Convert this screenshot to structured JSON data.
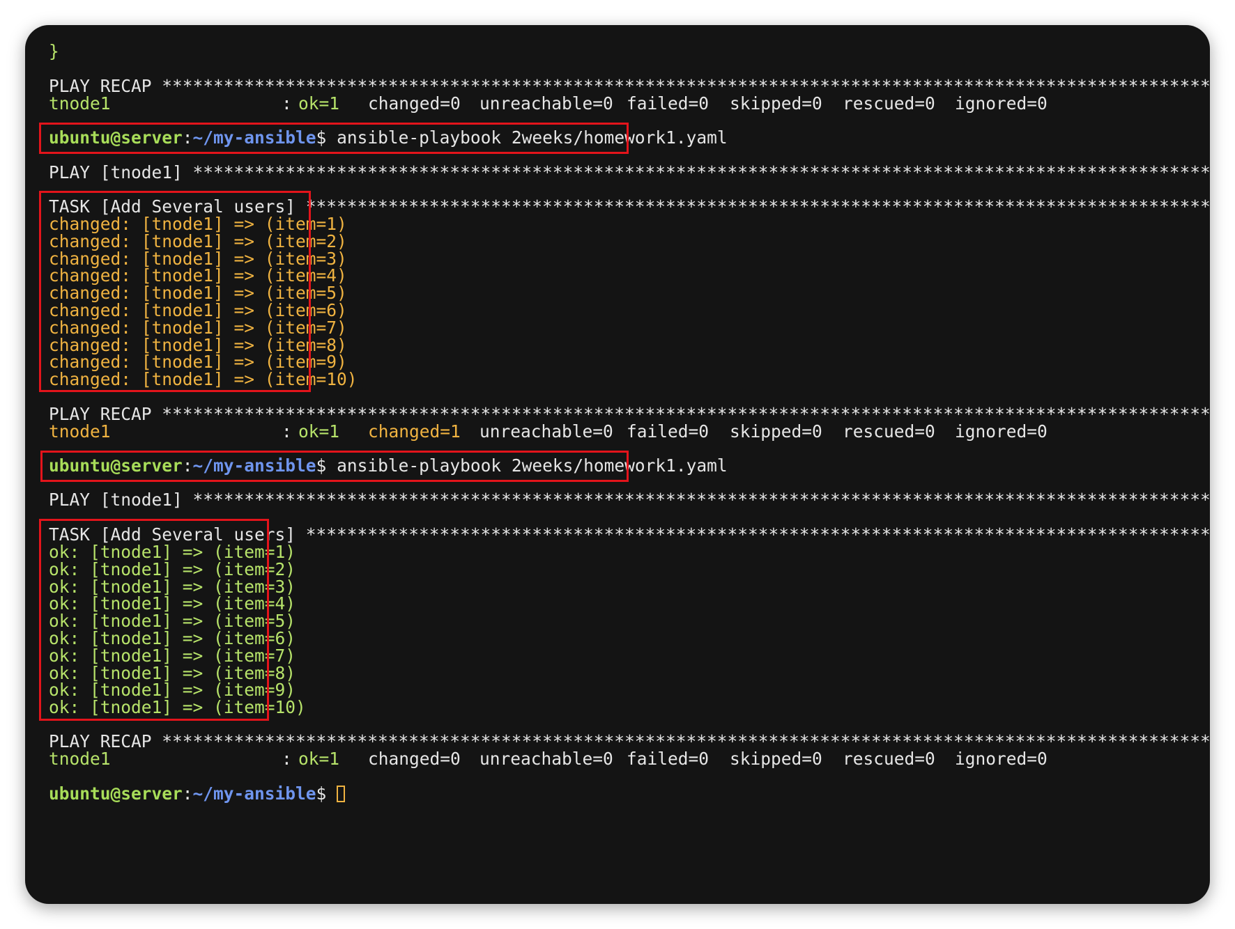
{
  "header_brace": "}",
  "stars": "**********************************************************************************************************************************************",
  "prompt": {
    "user": "ubuntu@server",
    "colon": ":",
    "path": "~/my-ansible",
    "dollar": "$ "
  },
  "command": "ansible-playbook 2weeks/homework1.yaml",
  "recap": {
    "label": "PLAY RECAP ",
    "host": "tnode1",
    "colon": ": ",
    "runs": [
      {
        "ok": "ok=1",
        "changed": "changed=0",
        "unreachable": "unreachable=0",
        "failed": "failed=0",
        "skipped": "skipped=0",
        "rescued": "rescued=0",
        "ignored": "ignored=0"
      },
      {
        "ok": "ok=1",
        "changed": "changed=1",
        "unreachable": "unreachable=0",
        "failed": "failed=0",
        "skipped": "skipped=0",
        "rescued": "rescued=0",
        "ignored": "ignored=0"
      },
      {
        "ok": "ok=1",
        "changed": "changed=0",
        "unreachable": "unreachable=0",
        "failed": "failed=0",
        "skipped": "skipped=0",
        "rescued": "rescued=0",
        "ignored": "ignored=0"
      }
    ]
  },
  "play_header": "PLAY [tnode1] ",
  "task_header": "TASK [Add Several users] ",
  "run1_results": [
    "changed: [tnode1] => (item=1)",
    "changed: [tnode1] => (item=2)",
    "changed: [tnode1] => (item=3)",
    "changed: [tnode1] => (item=4)",
    "changed: [tnode1] => (item=5)",
    "changed: [tnode1] => (item=6)",
    "changed: [tnode1] => (item=7)",
    "changed: [tnode1] => (item=8)",
    "changed: [tnode1] => (item=9)",
    "changed: [tnode1] => (item=10)"
  ],
  "run2_results": [
    "ok: [tnode1] => (item=1)",
    "ok: [tnode1] => (item=2)",
    "ok: [tnode1] => (item=3)",
    "ok: [tnode1] => (item=4)",
    "ok: [tnode1] => (item=5)",
    "ok: [tnode1] => (item=6)",
    "ok: [tnode1] => (item=7)",
    "ok: [tnode1] => (item=8)",
    "ok: [tnode1] => (item=9)",
    "ok: [tnode1] => (item=10)"
  ],
  "colors": {
    "background": "#141414",
    "changed": "#f0b341",
    "ok": "#b7e36a",
    "prompt_user": "#a8dd59",
    "prompt_path": "#6f95ee",
    "highlight_box": "#e3141b"
  }
}
